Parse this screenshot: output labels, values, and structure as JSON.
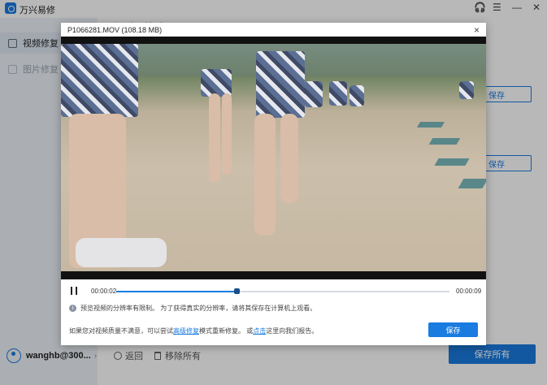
{
  "app": {
    "title": "万兴易修"
  },
  "window_controls": {
    "headset": "🎧",
    "menu": "☰",
    "minimize": "—",
    "close": "✕"
  },
  "sidebar": {
    "items": [
      {
        "label": "视频修复",
        "active": true,
        "icon": "video-repair-icon"
      },
      {
        "label": "图片修复",
        "active": false,
        "icon": "photo-repair-icon"
      }
    ]
  },
  "user": {
    "name": "wanghb@300...",
    "chevron": "›"
  },
  "main": {
    "title": "视频修复"
  },
  "list_actions": {
    "save_label_1": "保存",
    "save_label_2": "保存"
  },
  "bottom": {
    "back_label": "返回",
    "remove_all_label": "移除所有",
    "save_all_label": "保存所有"
  },
  "modal": {
    "title": "P1066281.MOV (108.18  MB)",
    "close": "×",
    "current_time": "00:00:02",
    "total_time": "00:00:09",
    "progress_fraction": 0.36,
    "notice_icon": "i",
    "notice": "预览视频的分辨率有限制。 为了获得真实的分辨率，请将其保存在计算机上观看。",
    "footer_prefix": "如果您对视频质量不满意，可以尝试",
    "footer_link1": "高级修复",
    "footer_mid": "模式重新修复。 或",
    "footer_link2": "点击",
    "footer_suffix": "这里向我们报告。",
    "save_label": "保存"
  },
  "colors": {
    "accent": "#1a7be0",
    "sidebar_bg": "#eef2f7"
  }
}
